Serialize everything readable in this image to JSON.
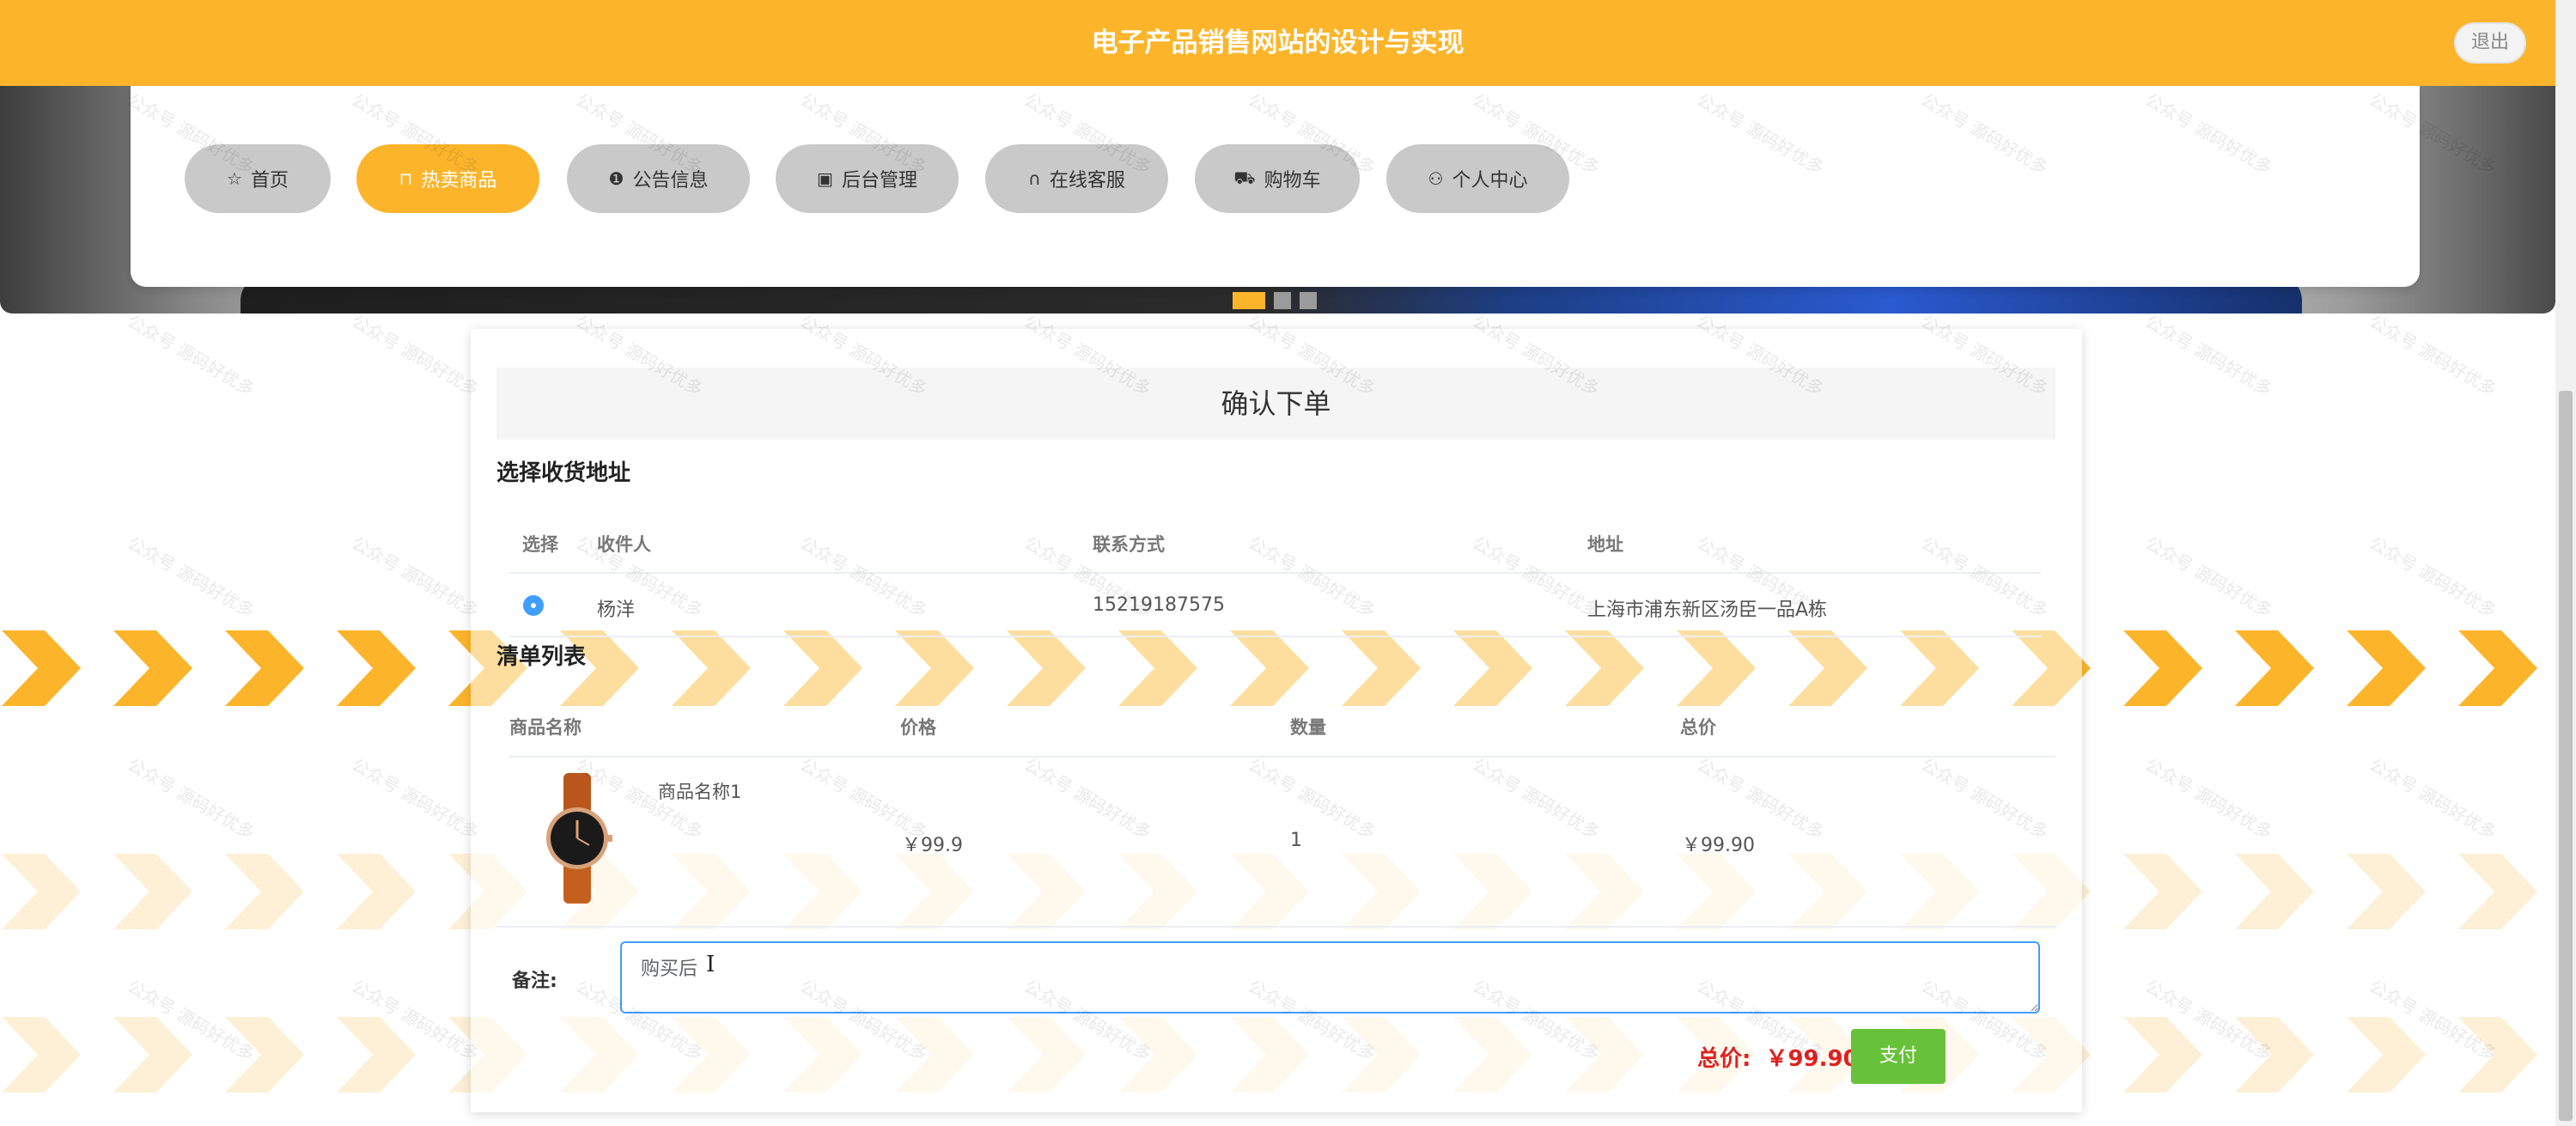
{
  "header": {
    "title": "电子产品销售网站的设计与实现",
    "logout_label": "退出"
  },
  "nav": {
    "items": [
      {
        "label": "首页",
        "icon": "star-icon",
        "glyph": "☆",
        "active": false
      },
      {
        "label": "热卖商品",
        "icon": "bag-icon",
        "glyph": "⊓",
        "active": true
      },
      {
        "label": "公告信息",
        "icon": "alert-icon",
        "glyph": "❶",
        "active": false
      },
      {
        "label": "后台管理",
        "icon": "box-icon",
        "glyph": "▣",
        "active": false
      },
      {
        "label": "在线客服",
        "icon": "headset-icon",
        "glyph": "∩",
        "active": false
      },
      {
        "label": "购物车",
        "icon": "cart-icon",
        "glyph": "⛟",
        "active": false
      },
      {
        "label": "个人中心",
        "icon": "user-icon",
        "glyph": "⚇",
        "active": false
      }
    ]
  },
  "carousel": {
    "slides": 3,
    "active_index": 0
  },
  "order": {
    "title": "确认下单",
    "address_section": {
      "title": "选择收货地址",
      "columns": [
        "选择",
        "收件人",
        "联系方式",
        "地址"
      ],
      "rows": [
        {
          "selected": true,
          "name": "杨洋",
          "phone": "15219187575",
          "address": "上海市浦东新区汤臣一品A栋"
        }
      ]
    },
    "items_section": {
      "title": "清单列表",
      "columns": [
        "商品名称",
        "价格",
        "数量",
        "总价"
      ],
      "rows": [
        {
          "name": "商品名称1",
          "price": "￥99.9",
          "qty": "1",
          "total": "￥99.90",
          "image": "watch-image"
        }
      ]
    },
    "remark": {
      "label": "备注:",
      "value": "购买后"
    },
    "total": {
      "label": "总价:",
      "value": "￥99.90"
    },
    "pay_label": "支付"
  },
  "watermark": {
    "text": "公众号 源码好优多"
  },
  "colors": {
    "primary": "#fcb52b",
    "pay": "#67c23a",
    "price": "#e02020",
    "focus": "#409eff"
  }
}
